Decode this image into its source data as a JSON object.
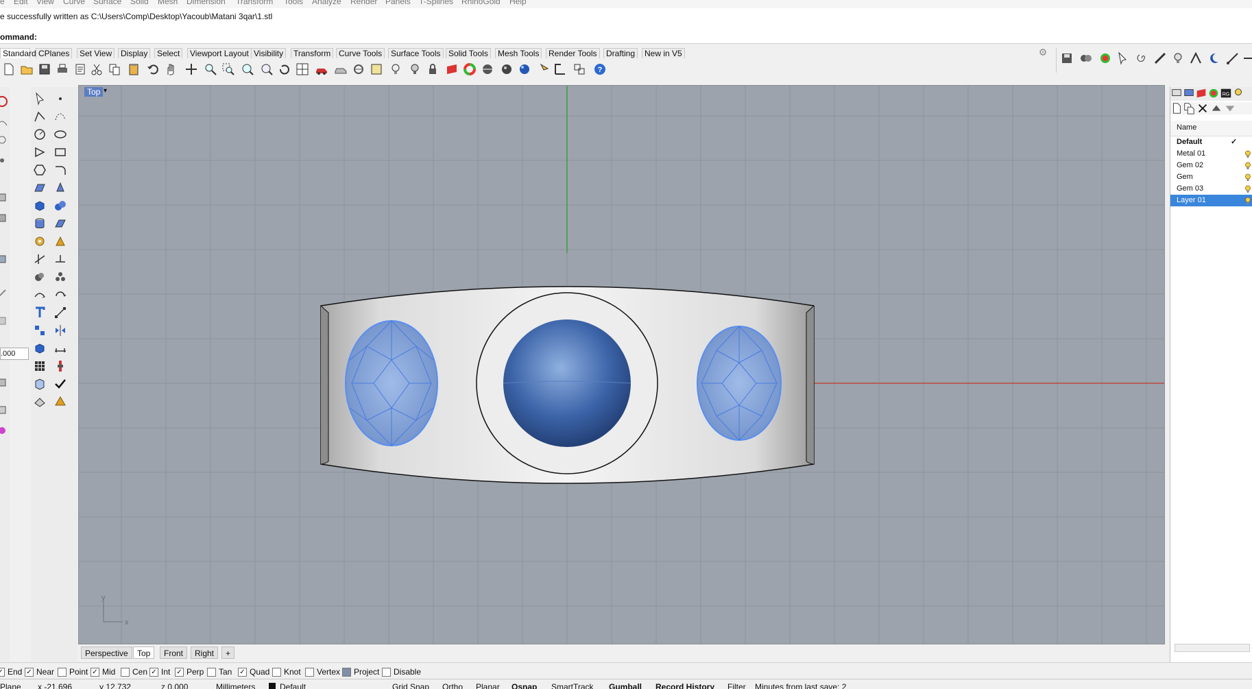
{
  "menu": [
    "e",
    "Edit",
    "View",
    "Curve",
    "Surface",
    "Solid",
    "Mesh",
    "Dimension",
    "Transform",
    "Tools",
    "Analyze",
    "Render",
    "Panels",
    "T-Splines",
    "RhinoGold",
    "Help"
  ],
  "command_history": "e successfully written as C:\\Users\\Comp\\Desktop\\Yacoub\\Matani 3qar\\1.stl",
  "command_prompt": "ommand:",
  "toolbar_tabs": [
    "Standard",
    "CPlanes",
    "Set View",
    "Display",
    "Select",
    "Viewport Layout",
    "Visibility",
    "Transform",
    "Curve Tools",
    "Surface Tools",
    "Solid Tools",
    "Mesh Tools",
    "Render Tools",
    "Drafting",
    "New in V5"
  ],
  "viewport": {
    "title": "Top",
    "axis_x_label": "x",
    "axis_y_label": "y",
    "colors": {
      "background": "#9da3ad",
      "grid": "#8d939d",
      "x_axis": "#c0392b",
      "y_axis": "#3aa040",
      "gem": "#6e9ae8",
      "ring": "#e8e8e8"
    }
  },
  "left_input_value": ".000",
  "viewport_tabs": [
    "Perspective",
    "Top",
    "Front",
    "Right",
    "+"
  ],
  "osnaps": [
    {
      "label": "End",
      "checked": true
    },
    {
      "label": "Near",
      "checked": true
    },
    {
      "label": "Point",
      "checked": false
    },
    {
      "label": "Mid",
      "checked": true
    },
    {
      "label": "Cen",
      "checked": false
    },
    {
      "label": "Int",
      "checked": true
    },
    {
      "label": "Perp",
      "checked": true
    },
    {
      "label": "Tan",
      "checked": false
    },
    {
      "label": "Quad",
      "checked": true
    },
    {
      "label": "Knot",
      "checked": false
    },
    {
      "label": "Vertex",
      "checked": false
    },
    {
      "label": "Project",
      "checked": false
    },
    {
      "label": "Disable",
      "checked": false
    }
  ],
  "status": {
    "cplane": "Plane",
    "x": "x -21.696",
    "y": "y 12.732",
    "z": "z 0.000",
    "units": "Millimeters",
    "layer": "Default",
    "grid_snap": "Grid Snap",
    "ortho": "Ortho",
    "planar": "Planar",
    "osnap": "Osnap",
    "smarttrack": "SmartTrack",
    "gumball": "Gumball",
    "record_history": "Record History",
    "filter": "Filter",
    "save_info": "Minutes from last save: 2"
  },
  "layers": {
    "header": "Name",
    "rows": [
      {
        "name": "Default",
        "current": true,
        "selected": false
      },
      {
        "name": "Metal 01",
        "current": false,
        "selected": false
      },
      {
        "name": "Gem 02",
        "current": false,
        "selected": false
      },
      {
        "name": "Gem",
        "current": false,
        "selected": false
      },
      {
        "name": "Gem 03",
        "current": false,
        "selected": false
      },
      {
        "name": "Layer 01",
        "current": false,
        "selected": true
      }
    ],
    "current_mark": "✓"
  },
  "icon_names": [
    "new-icon",
    "open-icon",
    "save-icon",
    "print-icon",
    "cut-icon",
    "copy-icon",
    "paste-icon",
    "undo-icon",
    "pan-icon",
    "zoom-icon",
    "lightbulb-icon",
    "lock-icon",
    "help-icon",
    "gear-icon"
  ]
}
